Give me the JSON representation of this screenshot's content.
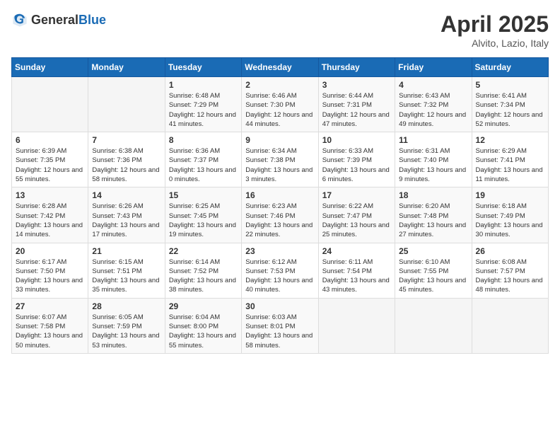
{
  "header": {
    "logo_general": "General",
    "logo_blue": "Blue",
    "title": "April 2025",
    "location": "Alvito, Lazio, Italy"
  },
  "days_of_week": [
    "Sunday",
    "Monday",
    "Tuesday",
    "Wednesday",
    "Thursday",
    "Friday",
    "Saturday"
  ],
  "weeks": [
    [
      {
        "day": "",
        "sunrise": "",
        "sunset": "",
        "daylight": ""
      },
      {
        "day": "",
        "sunrise": "",
        "sunset": "",
        "daylight": ""
      },
      {
        "day": "1",
        "sunrise": "Sunrise: 6:48 AM",
        "sunset": "Sunset: 7:29 PM",
        "daylight": "Daylight: 12 hours and 41 minutes."
      },
      {
        "day": "2",
        "sunrise": "Sunrise: 6:46 AM",
        "sunset": "Sunset: 7:30 PM",
        "daylight": "Daylight: 12 hours and 44 minutes."
      },
      {
        "day": "3",
        "sunrise": "Sunrise: 6:44 AM",
        "sunset": "Sunset: 7:31 PM",
        "daylight": "Daylight: 12 hours and 47 minutes."
      },
      {
        "day": "4",
        "sunrise": "Sunrise: 6:43 AM",
        "sunset": "Sunset: 7:32 PM",
        "daylight": "Daylight: 12 hours and 49 minutes."
      },
      {
        "day": "5",
        "sunrise": "Sunrise: 6:41 AM",
        "sunset": "Sunset: 7:34 PM",
        "daylight": "Daylight: 12 hours and 52 minutes."
      }
    ],
    [
      {
        "day": "6",
        "sunrise": "Sunrise: 6:39 AM",
        "sunset": "Sunset: 7:35 PM",
        "daylight": "Daylight: 12 hours and 55 minutes."
      },
      {
        "day": "7",
        "sunrise": "Sunrise: 6:38 AM",
        "sunset": "Sunset: 7:36 PM",
        "daylight": "Daylight: 12 hours and 58 minutes."
      },
      {
        "day": "8",
        "sunrise": "Sunrise: 6:36 AM",
        "sunset": "Sunset: 7:37 PM",
        "daylight": "Daylight: 13 hours and 0 minutes."
      },
      {
        "day": "9",
        "sunrise": "Sunrise: 6:34 AM",
        "sunset": "Sunset: 7:38 PM",
        "daylight": "Daylight: 13 hours and 3 minutes."
      },
      {
        "day": "10",
        "sunrise": "Sunrise: 6:33 AM",
        "sunset": "Sunset: 7:39 PM",
        "daylight": "Daylight: 13 hours and 6 minutes."
      },
      {
        "day": "11",
        "sunrise": "Sunrise: 6:31 AM",
        "sunset": "Sunset: 7:40 PM",
        "daylight": "Daylight: 13 hours and 9 minutes."
      },
      {
        "day": "12",
        "sunrise": "Sunrise: 6:29 AM",
        "sunset": "Sunset: 7:41 PM",
        "daylight": "Daylight: 13 hours and 11 minutes."
      }
    ],
    [
      {
        "day": "13",
        "sunrise": "Sunrise: 6:28 AM",
        "sunset": "Sunset: 7:42 PM",
        "daylight": "Daylight: 13 hours and 14 minutes."
      },
      {
        "day": "14",
        "sunrise": "Sunrise: 6:26 AM",
        "sunset": "Sunset: 7:43 PM",
        "daylight": "Daylight: 13 hours and 17 minutes."
      },
      {
        "day": "15",
        "sunrise": "Sunrise: 6:25 AM",
        "sunset": "Sunset: 7:45 PM",
        "daylight": "Daylight: 13 hours and 19 minutes."
      },
      {
        "day": "16",
        "sunrise": "Sunrise: 6:23 AM",
        "sunset": "Sunset: 7:46 PM",
        "daylight": "Daylight: 13 hours and 22 minutes."
      },
      {
        "day": "17",
        "sunrise": "Sunrise: 6:22 AM",
        "sunset": "Sunset: 7:47 PM",
        "daylight": "Daylight: 13 hours and 25 minutes."
      },
      {
        "day": "18",
        "sunrise": "Sunrise: 6:20 AM",
        "sunset": "Sunset: 7:48 PM",
        "daylight": "Daylight: 13 hours and 27 minutes."
      },
      {
        "day": "19",
        "sunrise": "Sunrise: 6:18 AM",
        "sunset": "Sunset: 7:49 PM",
        "daylight": "Daylight: 13 hours and 30 minutes."
      }
    ],
    [
      {
        "day": "20",
        "sunrise": "Sunrise: 6:17 AM",
        "sunset": "Sunset: 7:50 PM",
        "daylight": "Daylight: 13 hours and 33 minutes."
      },
      {
        "day": "21",
        "sunrise": "Sunrise: 6:15 AM",
        "sunset": "Sunset: 7:51 PM",
        "daylight": "Daylight: 13 hours and 35 minutes."
      },
      {
        "day": "22",
        "sunrise": "Sunrise: 6:14 AM",
        "sunset": "Sunset: 7:52 PM",
        "daylight": "Daylight: 13 hours and 38 minutes."
      },
      {
        "day": "23",
        "sunrise": "Sunrise: 6:12 AM",
        "sunset": "Sunset: 7:53 PM",
        "daylight": "Daylight: 13 hours and 40 minutes."
      },
      {
        "day": "24",
        "sunrise": "Sunrise: 6:11 AM",
        "sunset": "Sunset: 7:54 PM",
        "daylight": "Daylight: 13 hours and 43 minutes."
      },
      {
        "day": "25",
        "sunrise": "Sunrise: 6:10 AM",
        "sunset": "Sunset: 7:55 PM",
        "daylight": "Daylight: 13 hours and 45 minutes."
      },
      {
        "day": "26",
        "sunrise": "Sunrise: 6:08 AM",
        "sunset": "Sunset: 7:57 PM",
        "daylight": "Daylight: 13 hours and 48 minutes."
      }
    ],
    [
      {
        "day": "27",
        "sunrise": "Sunrise: 6:07 AM",
        "sunset": "Sunset: 7:58 PM",
        "daylight": "Daylight: 13 hours and 50 minutes."
      },
      {
        "day": "28",
        "sunrise": "Sunrise: 6:05 AM",
        "sunset": "Sunset: 7:59 PM",
        "daylight": "Daylight: 13 hours and 53 minutes."
      },
      {
        "day": "29",
        "sunrise": "Sunrise: 6:04 AM",
        "sunset": "Sunset: 8:00 PM",
        "daylight": "Daylight: 13 hours and 55 minutes."
      },
      {
        "day": "30",
        "sunrise": "Sunrise: 6:03 AM",
        "sunset": "Sunset: 8:01 PM",
        "daylight": "Daylight: 13 hours and 58 minutes."
      },
      {
        "day": "",
        "sunrise": "",
        "sunset": "",
        "daylight": ""
      },
      {
        "day": "",
        "sunrise": "",
        "sunset": "",
        "daylight": ""
      },
      {
        "day": "",
        "sunrise": "",
        "sunset": "",
        "daylight": ""
      }
    ]
  ]
}
